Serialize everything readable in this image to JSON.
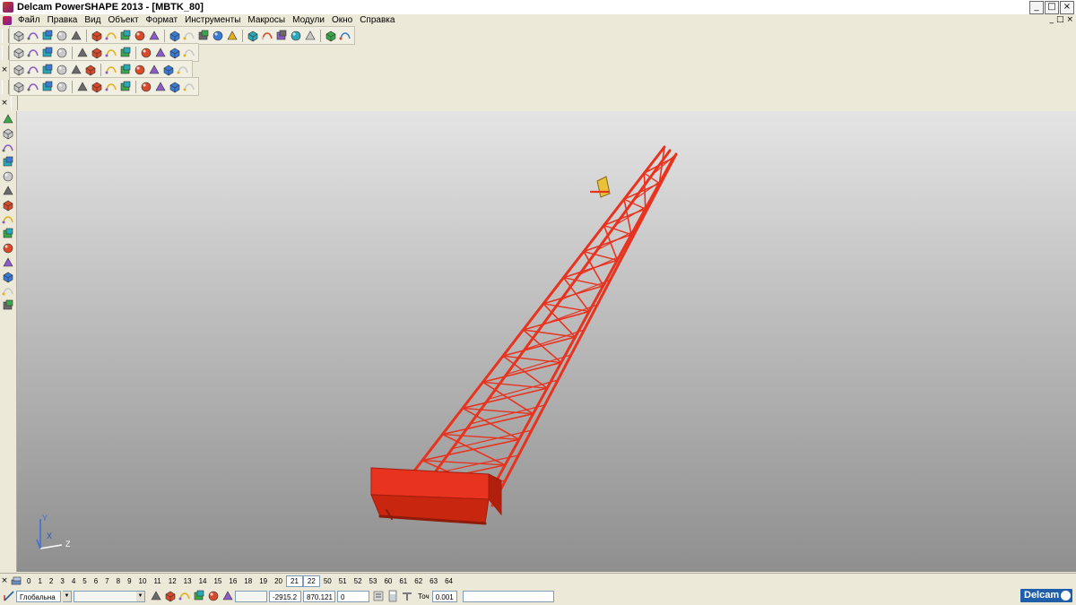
{
  "window": {
    "title": "Delcam PowerSHAPE 2013 - [MBTK_80]",
    "controls": [
      "_",
      "□",
      "×"
    ]
  },
  "menu": {
    "items": [
      "Файл",
      "Правка",
      "Вид",
      "Объект",
      "Формат",
      "Инструменты",
      "Макросы",
      "Модули",
      "Окно",
      "Справка"
    ],
    "doc_controls": [
      "_",
      "□",
      "×"
    ]
  },
  "toolbars": {
    "row1": [
      "new",
      "open",
      "save-as",
      "save",
      "print",
      "cut",
      "copy",
      "paste",
      "delete",
      "undo",
      "redo",
      "redraw",
      "select",
      "axes",
      "circle",
      "curve",
      "dimension",
      "shape",
      "model",
      "surface",
      "solid",
      "tools"
    ],
    "row2": [
      "view-top",
      "view-front",
      "view-side",
      "view-iso",
      "zoom-in",
      "zoom-out",
      "zoom-all",
      "globe",
      "shaded",
      "wireframe",
      "light",
      "hand"
    ],
    "row3": [
      "curve",
      "edit",
      "sphere",
      "cone",
      "line",
      "surface",
      "blend",
      "box",
      "cylinder",
      "torus",
      "fillet",
      "offset"
    ],
    "row4": [
      "mesh",
      "axis",
      "surface",
      "cube",
      "grid",
      "box2",
      "chamfer",
      "extrude",
      "lattice",
      "arrow",
      "pipe",
      "solid"
    ]
  },
  "left_palette": [
    "select",
    "select-all",
    "dot",
    "warning",
    "wire",
    "fillet",
    "blend",
    "copy",
    "plus",
    "move",
    "solid1",
    "solid2",
    "solid3",
    "solid4"
  ],
  "viewport": {
    "axis_labels": {
      "y": "Y",
      "x": "X",
      "z": "Z"
    },
    "model_color": "#e8331f"
  },
  "layers": {
    "numbers": [
      "0",
      "1",
      "2",
      "3",
      "4",
      "5",
      "6",
      "7",
      "8",
      "9",
      "10",
      "11",
      "12",
      "13",
      "14",
      "15",
      "16",
      "18",
      "19",
      "20",
      "21",
      "22",
      "50",
      "51",
      "52",
      "53",
      "60",
      "61",
      "62",
      "63",
      "64"
    ],
    "active": [
      "21",
      "22"
    ]
  },
  "status": {
    "workplane": "Глобальна",
    "coord_x": "-2915.2",
    "coord_y": "870.121",
    "coord_z": "0",
    "tolerance_label": "Точ",
    "tolerance_value": "0.001",
    "brand": "Delcam"
  }
}
